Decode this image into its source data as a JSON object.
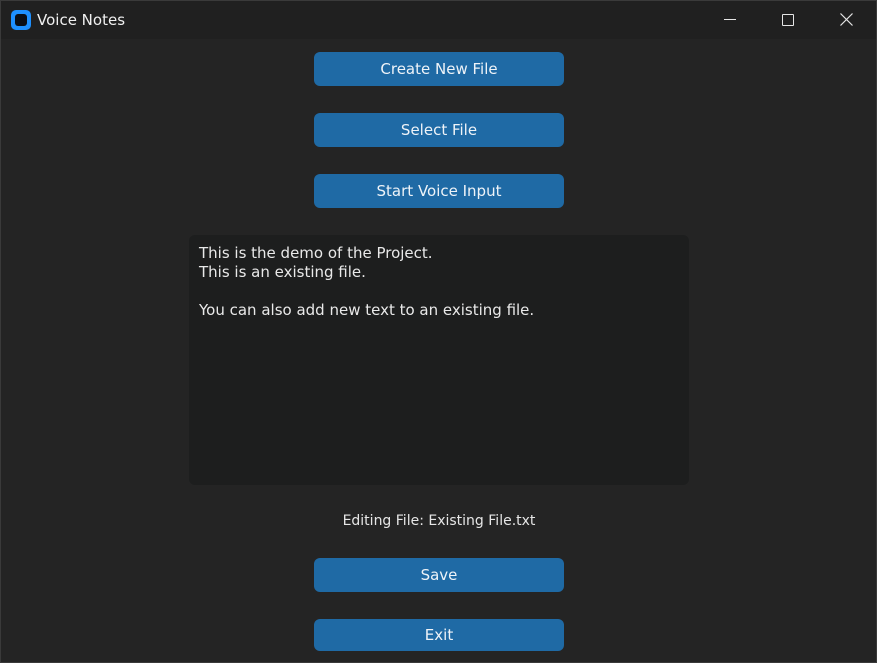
{
  "window": {
    "title": "Voice Notes",
    "app_icon": "app-icon",
    "controls": {
      "minimize": "minimize-icon",
      "maximize": "maximize-icon",
      "close": "close-icon"
    }
  },
  "buttons": {
    "create_new_file": "Create New File",
    "select_file": "Select File",
    "start_voice_input": "Start Voice Input",
    "save": "Save",
    "exit": "Exit"
  },
  "editor": {
    "lines": [
      "This is the demo of the Project.",
      "This is an existing file.",
      "",
      "You can also add new text to an existing file."
    ]
  },
  "status": {
    "editing_file": "Editing File: Existing File.txt"
  },
  "colors": {
    "background": "#242424",
    "titlebar": "#202020",
    "button": "#1f6aa5",
    "textbox": "#1d1e1e",
    "accent_icon": "#1e90ff"
  }
}
